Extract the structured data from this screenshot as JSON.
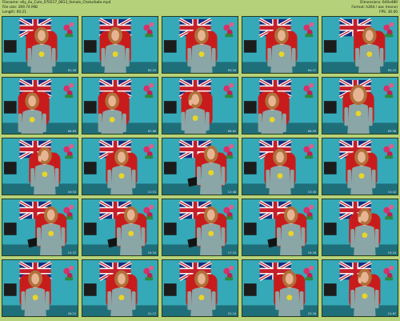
{
  "header": {
    "filename": "Filename: elly_4u_Cute_070217_0813_female_Chaturbate.mp4",
    "filesize": "File size: 269.74 MiB",
    "length": "Length: 00:21",
    "dimensions": "Dimensions: 640x480",
    "format": "Format: h264 / aac (mono)",
    "fps": "FPS: 30.00"
  },
  "thumbnails": [
    {
      "timestamp": "01:28",
      "variant": "sit"
    },
    {
      "timestamp": "02:23",
      "variant": "sit-left"
    },
    {
      "timestamp": "03:20",
      "variant": "sit"
    },
    {
      "timestamp": "04:17",
      "variant": "sit"
    },
    {
      "timestamp": "05:13",
      "variant": "sit-right"
    },
    {
      "timestamp": "06:09",
      "variant": "lean"
    },
    {
      "timestamp": "07:08",
      "variant": "lean"
    },
    {
      "timestamp": "08:02",
      "variant": "lean-hand"
    },
    {
      "timestamp": "08:59",
      "variant": "lean"
    },
    {
      "timestamp": "09:56",
      "variant": "close"
    },
    {
      "timestamp": "10:53",
      "variant": "hand-face"
    },
    {
      "timestamp": "11:51",
      "variant": "sit"
    },
    {
      "timestamp": "12:48",
      "variant": "legs"
    },
    {
      "timestamp": "13:45",
      "variant": "sit-center"
    },
    {
      "timestamp": "14:42",
      "variant": "sit"
    },
    {
      "timestamp": "15:37",
      "variant": "legs"
    },
    {
      "timestamp": "16:34",
      "variant": "legs"
    },
    {
      "timestamp": "17:31",
      "variant": "legs"
    },
    {
      "timestamp": "18:28",
      "variant": "legs"
    },
    {
      "timestamp": "19:24",
      "variant": "hand-face"
    },
    {
      "timestamp": "20:21",
      "variant": "sit-left"
    },
    {
      "timestamp": "21:17",
      "variant": "sit"
    },
    {
      "timestamp": "22:14",
      "variant": "sit"
    },
    {
      "timestamp": "23:10",
      "variant": "sit-right"
    },
    {
      "timestamp": "24:07",
      "variant": "hand-face"
    }
  ],
  "colors": {
    "background": "#b5d27a",
    "wall": "#35a9b8",
    "chair": "#c81c1c",
    "shirt": "#8aa6a6",
    "hair": "#b0703a",
    "skin": "#e6b493",
    "flag_blue": "#1a2c7a",
    "flag_red": "#c41f2a"
  }
}
